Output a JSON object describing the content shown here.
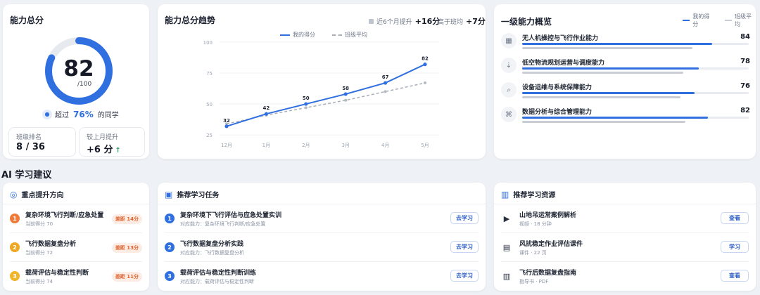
{
  "overall": {
    "title": "能力总分",
    "score": 82,
    "score_denominator": "/100",
    "exceed_prefix": "超过",
    "exceed_percent": "76%",
    "exceed_suffix": "的同学",
    "exceed_fraction": 0.82,
    "rank_label": "班级排名",
    "rank_value": "8 / 36",
    "improve_label": "较上月提升",
    "improve_value": "+6 分",
    "improve_arrow": "↑"
  },
  "trend": {
    "title": "能力总分趋势",
    "stat1_label": "近6个月提升",
    "stat1_value": "+16分",
    "stat2_label": "高于班均",
    "stat2_value": "+7分",
    "legend_mine": "我的得分",
    "legend_avg": "班级平均"
  },
  "chart_data": {
    "type": "line",
    "categories": [
      "12月",
      "1月",
      "2月",
      "3月",
      "4月",
      "5月"
    ],
    "series": [
      {
        "name": "我的得分",
        "values": [
          32,
          42,
          50,
          58,
          67,
          82
        ],
        "color": "#2f6fe0"
      },
      {
        "name": "班级平均",
        "values": [
          34,
          41,
          47,
          53,
          60,
          67
        ],
        "color": "#a9aeb8"
      }
    ],
    "yticks": [
      25,
      50,
      75,
      100
    ],
    "ylim": [
      20,
      105
    ],
    "grid": true,
    "legend": "top-center"
  },
  "abilities": {
    "title": "一级能力概览",
    "legend_mine": "我的得分",
    "legend_avg": "班级平均",
    "items": [
      {
        "icon": "drone-icon",
        "glyph": "▦",
        "name": "无人机操控与飞行作业能力",
        "value": "84",
        "mine": 0.84,
        "avg": 0.75
      },
      {
        "icon": "logistics-icon",
        "glyph": "⇣",
        "name": "低空物流规划运营与调度能力",
        "value": "78",
        "mine": 0.78,
        "avg": 0.71
      },
      {
        "icon": "maintenance-icon",
        "glyph": "⌕",
        "name": "设备运维与系统保障能力",
        "value": "76",
        "mine": 0.76,
        "avg": 0.7
      },
      {
        "icon": "data-analysis-icon",
        "glyph": "⌘",
        "name": "数据分析与综合管理能力",
        "value": "82",
        "mine": 0.82,
        "avg": 0.72
      }
    ]
  },
  "ai": {
    "title": "AI 学习建议",
    "focus": {
      "title": "重点提升方向",
      "items": [
        {
          "num": "1",
          "color": "#f07a3a",
          "title": "复杂环境飞行判断/应急处置",
          "sub": "当前得分 70",
          "gap": "差距 14分"
        },
        {
          "num": "2",
          "color": "#f0a722",
          "title": "飞行数据复盘分析",
          "sub": "当前得分 72",
          "gap": "差距 13分"
        },
        {
          "num": "3",
          "color": "#f0b52a",
          "title": "载荷评估与稳定性判断",
          "sub": "当前得分 74",
          "gap": "差距 11分"
        }
      ]
    },
    "tasks": {
      "title": "推荐学习任务",
      "items": [
        {
          "num": "1",
          "title": "复杂环境下飞行评估与应急处置实训",
          "sub": "对应能力：复杂环境飞行判断/应急处置",
          "btn": "去学习"
        },
        {
          "num": "2",
          "title": "飞行数据复盘分析实践",
          "sub": "对应能力：飞行数据复盘分析",
          "btn": "去学习"
        },
        {
          "num": "3",
          "title": "载荷评估与稳定性判断训练",
          "sub": "对应能力：载荷评估与稳定性判断",
          "btn": "去学习"
        }
      ]
    },
    "resources": {
      "title": "推荐学习资源",
      "items": [
        {
          "icon": "video-icon",
          "glyph": "▶",
          "title": "山地吊运常案例解析",
          "sub": "视频 · 18 分钟",
          "btn": "查看"
        },
        {
          "icon": "document-icon",
          "glyph": "▤",
          "title": "风扰稳定作业评估课件",
          "sub": "课件 · 22 页",
          "btn": "学习"
        },
        {
          "icon": "book-icon",
          "glyph": "▥",
          "title": "飞行后数据复盘指南",
          "sub": "指导书 · PDF",
          "btn": "查看"
        }
      ]
    }
  }
}
